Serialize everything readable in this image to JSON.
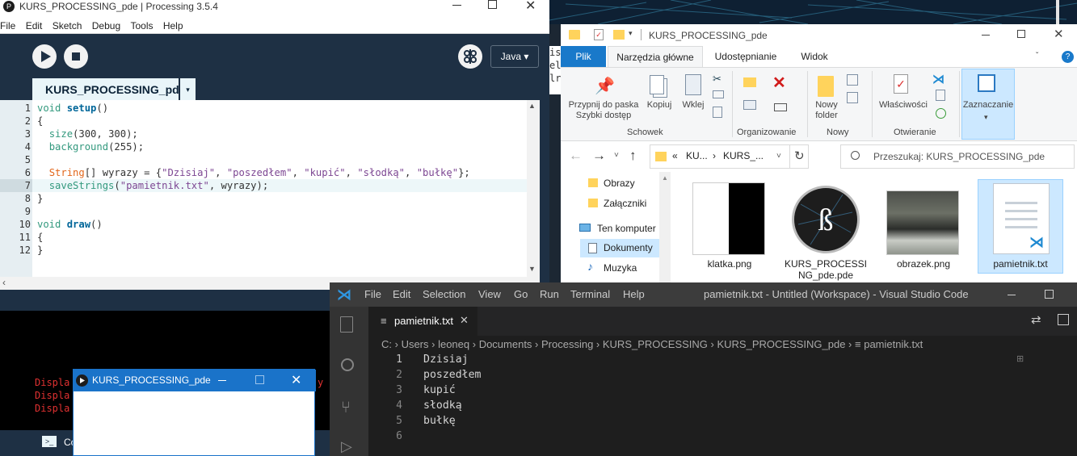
{
  "processing": {
    "title": "KURS_PROCESSING_pde | Processing 3.5.4",
    "menu": [
      "File",
      "Edit",
      "Sketch",
      "Debug",
      "Tools",
      "Help"
    ],
    "mode": "Java ▾",
    "tab_name": "KURS_PROCESSING_pde",
    "tab_arrow": "▾",
    "line_numbers": [
      "1",
      "2",
      "3",
      "4",
      "5",
      "6",
      "7",
      "8",
      "9",
      "10",
      "11",
      "12"
    ],
    "code": [
      [
        {
          "t": "void ",
          "c": "kw"
        },
        {
          "t": "setup",
          "c": "fn"
        },
        {
          "t": "()",
          "c": ""
        }
      ],
      [
        {
          "t": "{",
          "c": ""
        }
      ],
      [
        {
          "t": "  ",
          "c": ""
        },
        {
          "t": "size",
          "c": "kw"
        },
        {
          "t": "(300, 300);",
          "c": ""
        }
      ],
      [
        {
          "t": "  ",
          "c": ""
        },
        {
          "t": "background",
          "c": "kw"
        },
        {
          "t": "(255);",
          "c": ""
        }
      ],
      [],
      [
        {
          "t": "  ",
          "c": ""
        },
        {
          "t": "String",
          "c": "typ"
        },
        {
          "t": "[] wyrazy = {",
          "c": ""
        },
        {
          "t": "\"Dzisiaj\"",
          "c": "str"
        },
        {
          "t": ", ",
          "c": ""
        },
        {
          "t": "\"poszedłem\"",
          "c": "str"
        },
        {
          "t": ", ",
          "c": ""
        },
        {
          "t": "\"kupić\"",
          "c": "str"
        },
        {
          "t": ", ",
          "c": ""
        },
        {
          "t": "\"słodką\"",
          "c": "str"
        },
        {
          "t": ", ",
          "c": ""
        },
        {
          "t": "\"bułkę\"",
          "c": "str"
        },
        {
          "t": "};",
          "c": ""
        }
      ],
      [
        {
          "t": "  ",
          "c": ""
        },
        {
          "t": "saveStrings",
          "c": "kw"
        },
        {
          "t": "(",
          "c": ""
        },
        {
          "t": "\"pamietnik.txt\"",
          "c": "str"
        },
        {
          "t": ", wyrazy);",
          "c": ""
        }
      ],
      [
        {
          "t": "}",
          "c": ""
        }
      ],
      [],
      [
        {
          "t": "void ",
          "c": "kw"
        },
        {
          "t": "draw",
          "c": "fn"
        },
        {
          "t": "()",
          "c": ""
        }
      ],
      [
        {
          "t": "{",
          "c": ""
        }
      ],
      [
        {
          "t": "}",
          "c": ""
        }
      ]
    ],
    "console_lines": [
      "Displa",
      "Displa",
      "Displa"
    ],
    "console_tail": "y",
    "bottom_tab_partial": "Co"
  },
  "sketch_window": {
    "title": "KURS_PROCESSING_pde"
  },
  "explorer": {
    "title": "KURS_PROCESSING_pde",
    "tabs": [
      "Plik",
      "Narzędzia główne",
      "Udostępnianie",
      "Widok"
    ],
    "ribbon": {
      "pin": "Przypnij do paska Szybki dostęp",
      "copy": "Kopiuj",
      "paste": "Wklej",
      "group_clipboard": "Schowek",
      "group_organize": "Organizowanie",
      "new_folder": "Nowy folder",
      "group_new": "Nowy",
      "properties": "Właściwości",
      "group_open": "Otwieranie",
      "select": "Zaznaczanie"
    },
    "address": [
      "«",
      "KU...",
      "›",
      "KURS_..."
    ],
    "search_placeholder": "Przeszukaj: KURS_PROCESSING_pde",
    "nav": [
      "Obrazy",
      "Załączniki",
      "Ten komputer",
      "Dokumenty",
      "Muzyka"
    ],
    "files": [
      "klatka.png",
      "KURS_PROCESSING_pde.pde",
      "obrazek.png",
      "pamietnik.txt"
    ],
    "file_label_lines": {
      "kurs_1": "KURS_PROCESSI",
      "kurs_2": "NG_pde.pde"
    },
    "left_edge_letters": [
      "is",
      "el",
      "lr"
    ]
  },
  "vscode": {
    "menu": [
      "File",
      "Edit",
      "Selection",
      "View",
      "Go",
      "Run",
      "Terminal",
      "Help"
    ],
    "title": "pamietnik.txt - Untitled (Workspace) - Visual Studio Code",
    "tab": "pamietnik.txt",
    "breadcrumb": [
      "C:",
      "Users",
      "leoneq",
      "Documents",
      "Processing",
      "KURS_PROCESSING",
      "KURS_PROCESSING_pde",
      "pamietnik.txt"
    ],
    "line_numbers": [
      "1",
      "2",
      "3",
      "4",
      "5",
      "6"
    ],
    "lines": [
      "Dzisiaj",
      "poszedłem",
      "kupić",
      "słodką",
      "bułkę",
      ""
    ]
  }
}
